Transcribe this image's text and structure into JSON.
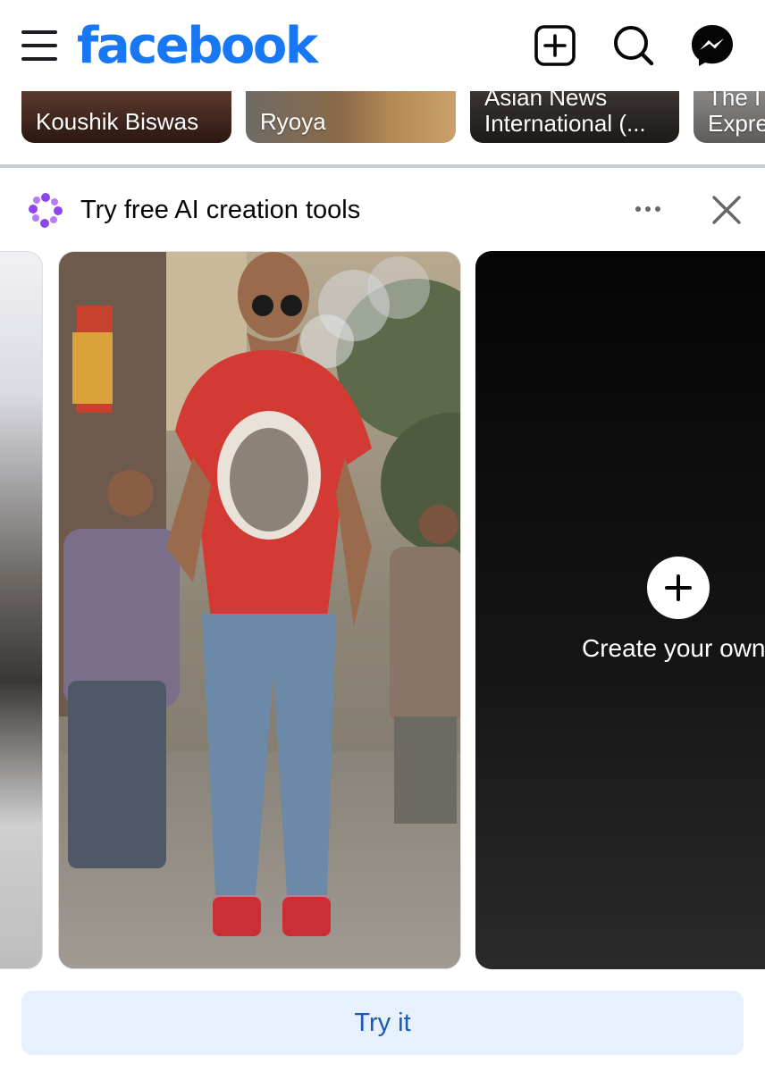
{
  "header": {
    "logo_text": "facebook",
    "icons": [
      "menu-icon",
      "create-plus-icon",
      "search-icon",
      "messenger-icon"
    ]
  },
  "stories": [
    {
      "name": "Koushik Biswas"
    },
    {
      "name": "Ryoya"
    },
    {
      "name_line1": "Asian News",
      "name_line2": "International (..."
    },
    {
      "name_line1": "The I",
      "name_line2": "Expre"
    }
  ],
  "ai_section": {
    "title": "Try free AI creation tools",
    "icon": "ai-sparkle-icon",
    "create_label": "Create your own",
    "try_button": "Try it"
  },
  "colors": {
    "brand": "#1877f2",
    "button_bg": "#e7f0fd",
    "button_text": "#1b5ab8",
    "ai_icon": "#8e44f0"
  }
}
